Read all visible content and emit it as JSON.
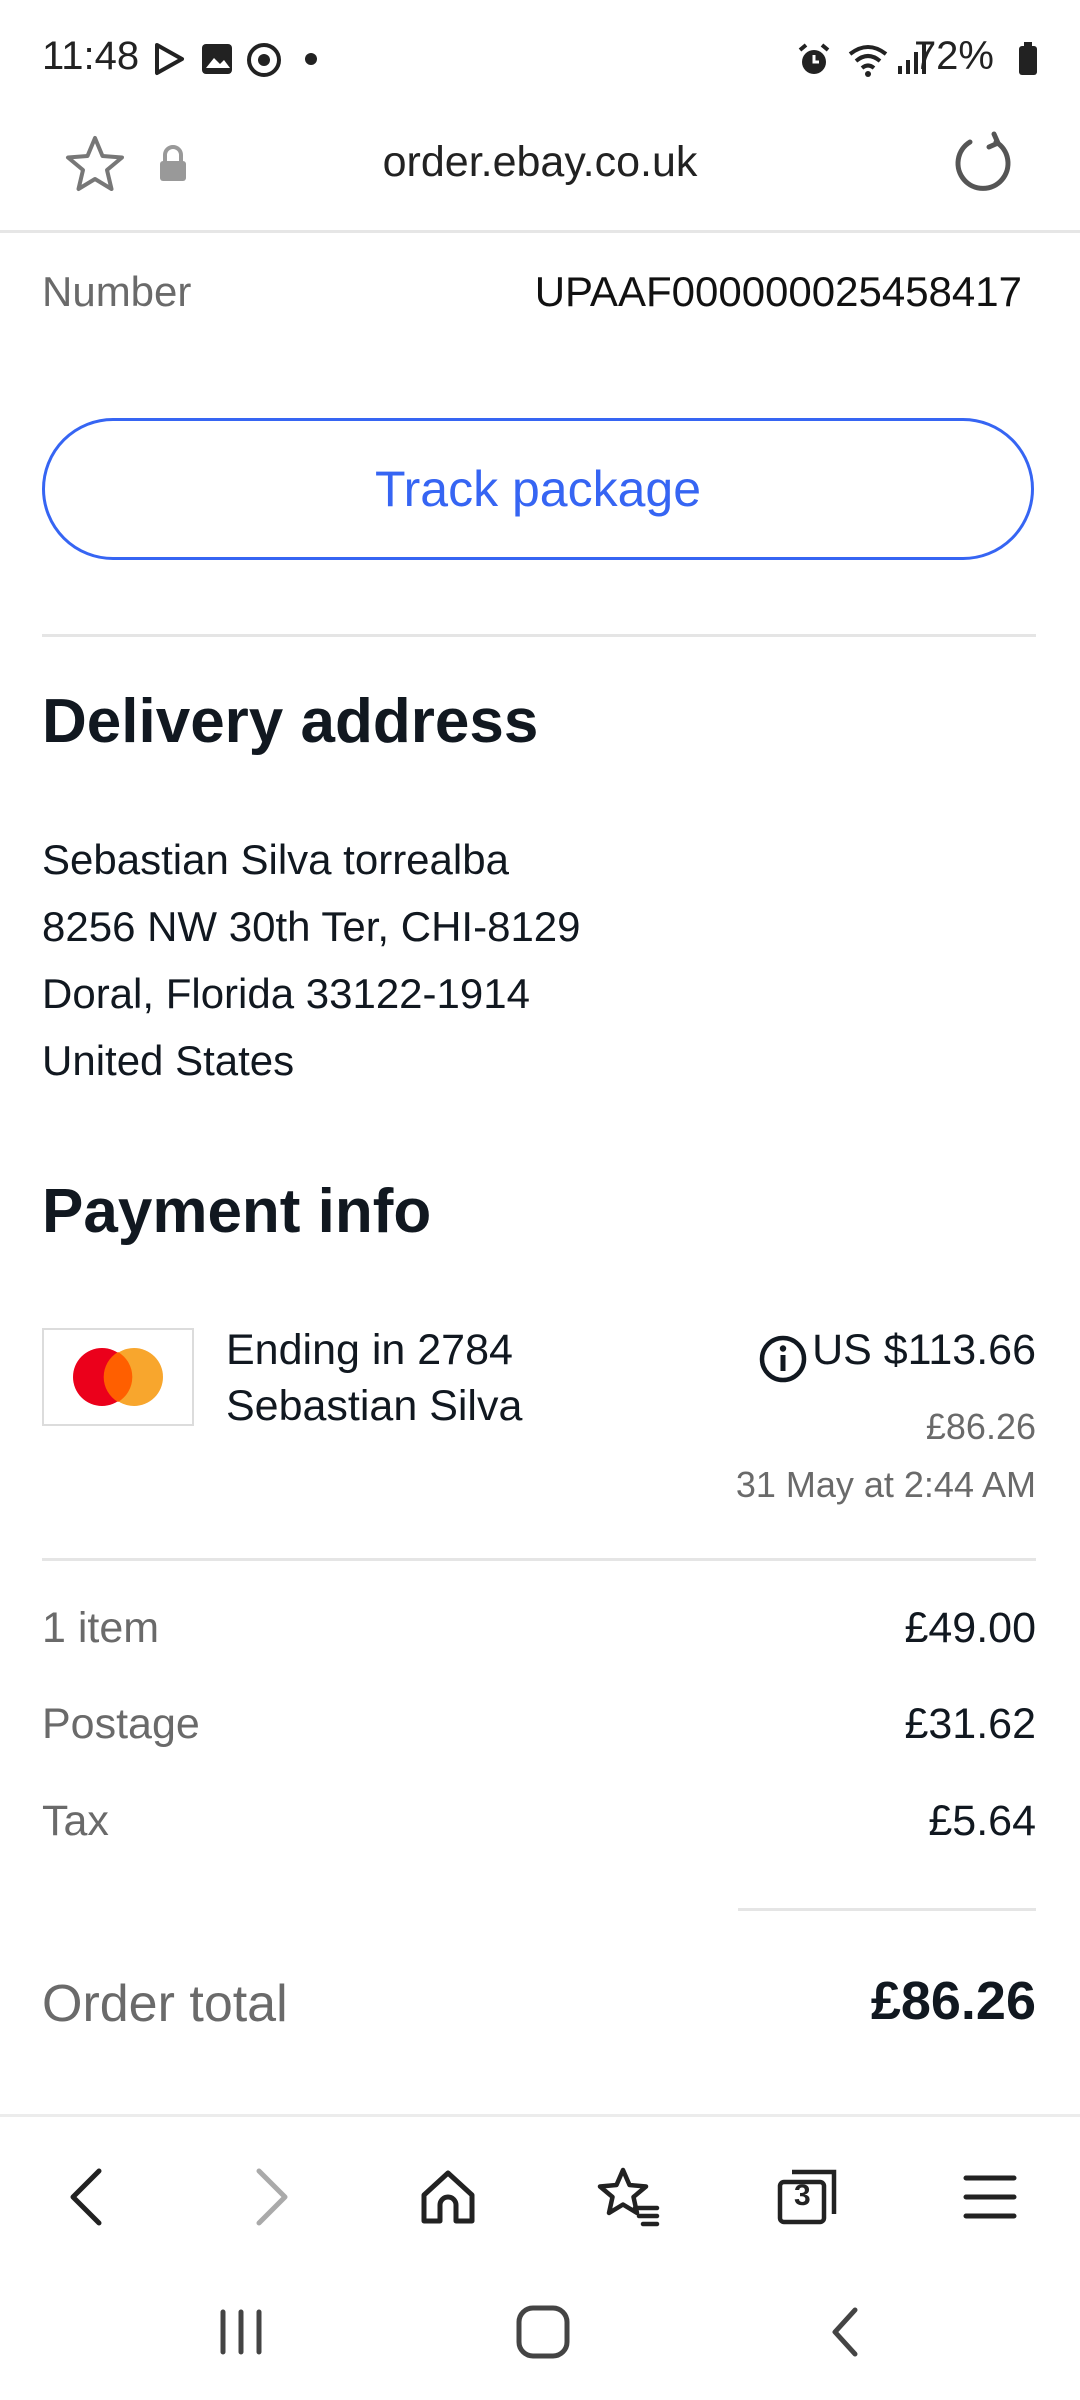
{
  "status_bar": {
    "time": "11:48",
    "battery": "72%",
    "left_icons": [
      "play-store-icon",
      "gallery-icon",
      "chrome-icon",
      "dot-icon"
    ],
    "right_icons": [
      "alarm-icon",
      "wifi-icon",
      "signal-icon",
      "battery-icon"
    ]
  },
  "url_bar": {
    "url": "order.ebay.co.uk"
  },
  "tracking": {
    "number_label": "Number",
    "number_value": "UPAAF000000025458417",
    "track_button": "Track package"
  },
  "delivery": {
    "title": "Delivery address",
    "lines": [
      "Sebastian Silva torrealba",
      "8256 NW 30th Ter, CHI-8129",
      "Doral, Florida 33122-1914",
      "United States"
    ]
  },
  "payment": {
    "title": "Payment info",
    "card_ending": "Ending in 2784",
    "card_holder": "Sebastian Silva",
    "amount_usd": "US $113.66",
    "amount_gbp": "£86.26",
    "date": "31 May at 2:44 AM"
  },
  "summary": {
    "rows": [
      {
        "label": "1 item",
        "value": "£49.00"
      },
      {
        "label": "Postage",
        "value": "£31.62"
      },
      {
        "label": "Tax",
        "value": "£5.64"
      }
    ],
    "total_label": "Order total",
    "total_value": "£86.26"
  },
  "browser_toolbar": {
    "tab_count": "3"
  },
  "colors": {
    "accent": "#3665f3",
    "text": "#111820",
    "grey": "#6a6a6a"
  }
}
